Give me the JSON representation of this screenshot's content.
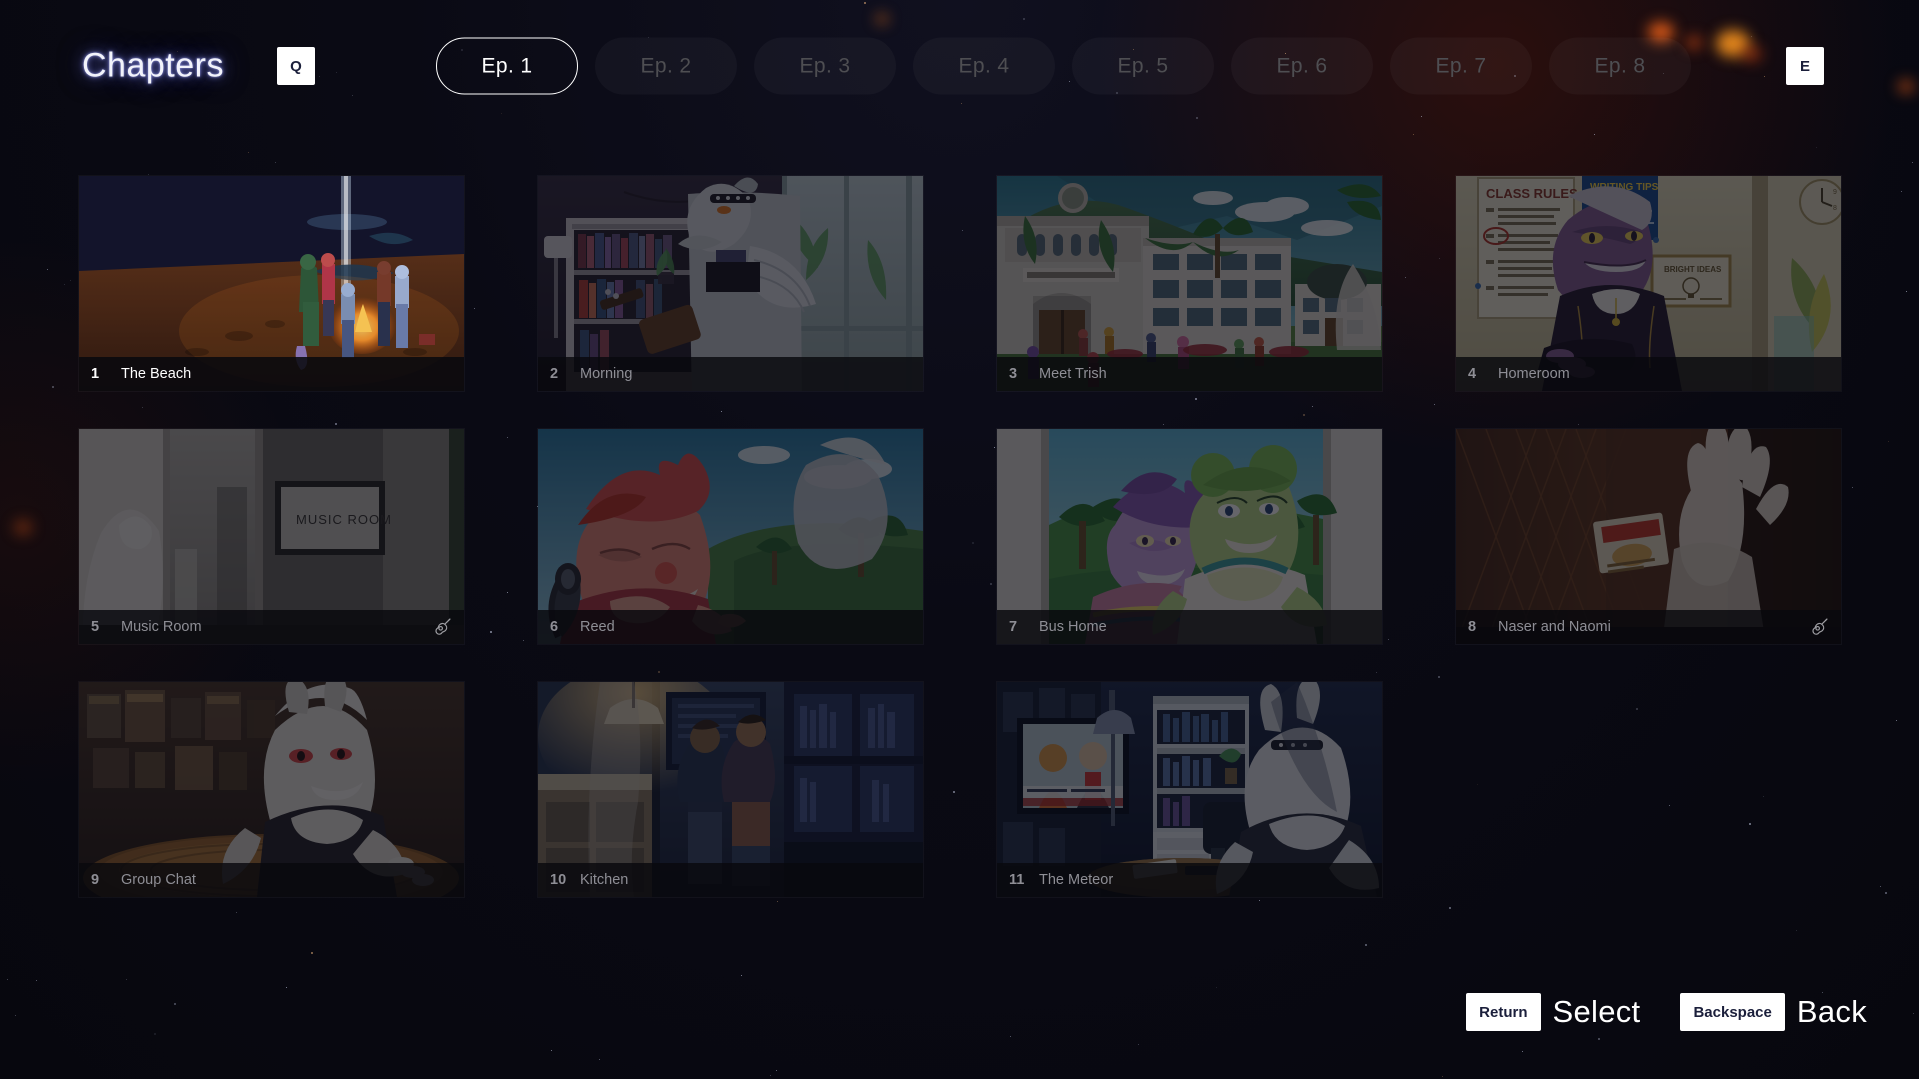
{
  "header": {
    "title": "Chapters",
    "prev_key": "Q",
    "next_key": "E",
    "episodes": [
      {
        "label": "Ep. 1",
        "selected": true
      },
      {
        "label": "Ep. 2",
        "selected": false
      },
      {
        "label": "Ep. 3",
        "selected": false
      },
      {
        "label": "Ep. 4",
        "selected": false
      },
      {
        "label": "Ep. 5",
        "selected": false
      },
      {
        "label": "Ep. 6",
        "selected": false
      },
      {
        "label": "Ep. 7",
        "selected": false
      },
      {
        "label": "Ep. 8",
        "selected": false
      }
    ]
  },
  "chapters": [
    {
      "number": "1",
      "title": "The Beach",
      "active": true,
      "guitar": false,
      "scene": "beach"
    },
    {
      "number": "2",
      "title": "Morning",
      "active": false,
      "guitar": false,
      "scene": "bedroom"
    },
    {
      "number": "3",
      "title": "Meet Trish",
      "active": false,
      "guitar": false,
      "scene": "school"
    },
    {
      "number": "4",
      "title": "Homeroom",
      "active": false,
      "guitar": false,
      "scene": "classroom"
    },
    {
      "number": "5",
      "title": "Music Room",
      "active": false,
      "guitar": true,
      "scene": "musicroom"
    },
    {
      "number": "6",
      "title": "Reed",
      "active": false,
      "guitar": false,
      "scene": "reed"
    },
    {
      "number": "7",
      "title": "Bus Home",
      "active": false,
      "guitar": false,
      "scene": "bus"
    },
    {
      "number": "8",
      "title": "Naser and Naomi",
      "active": false,
      "guitar": true,
      "scene": "hallway"
    },
    {
      "number": "9",
      "title": "Group Chat",
      "active": false,
      "guitar": false,
      "scene": "groupchat"
    },
    {
      "number": "10",
      "title": "Kitchen",
      "active": false,
      "guitar": false,
      "scene": "kitchen"
    },
    {
      "number": "11",
      "title": "The Meteor",
      "active": false,
      "guitar": false,
      "scene": "meteor"
    }
  ],
  "footer": {
    "prompts": [
      {
        "key": "Return",
        "action": "Select"
      },
      {
        "key": "Backspace",
        "action": "Back"
      }
    ]
  },
  "colors": {
    "background": "#07070f",
    "accent_glow": "#6d72c4",
    "keycap_bg": "#ffffff",
    "keycap_text": "#1b1f3b",
    "selected_tab_border": "#ffffff",
    "dim_text": "#4e4e52"
  }
}
